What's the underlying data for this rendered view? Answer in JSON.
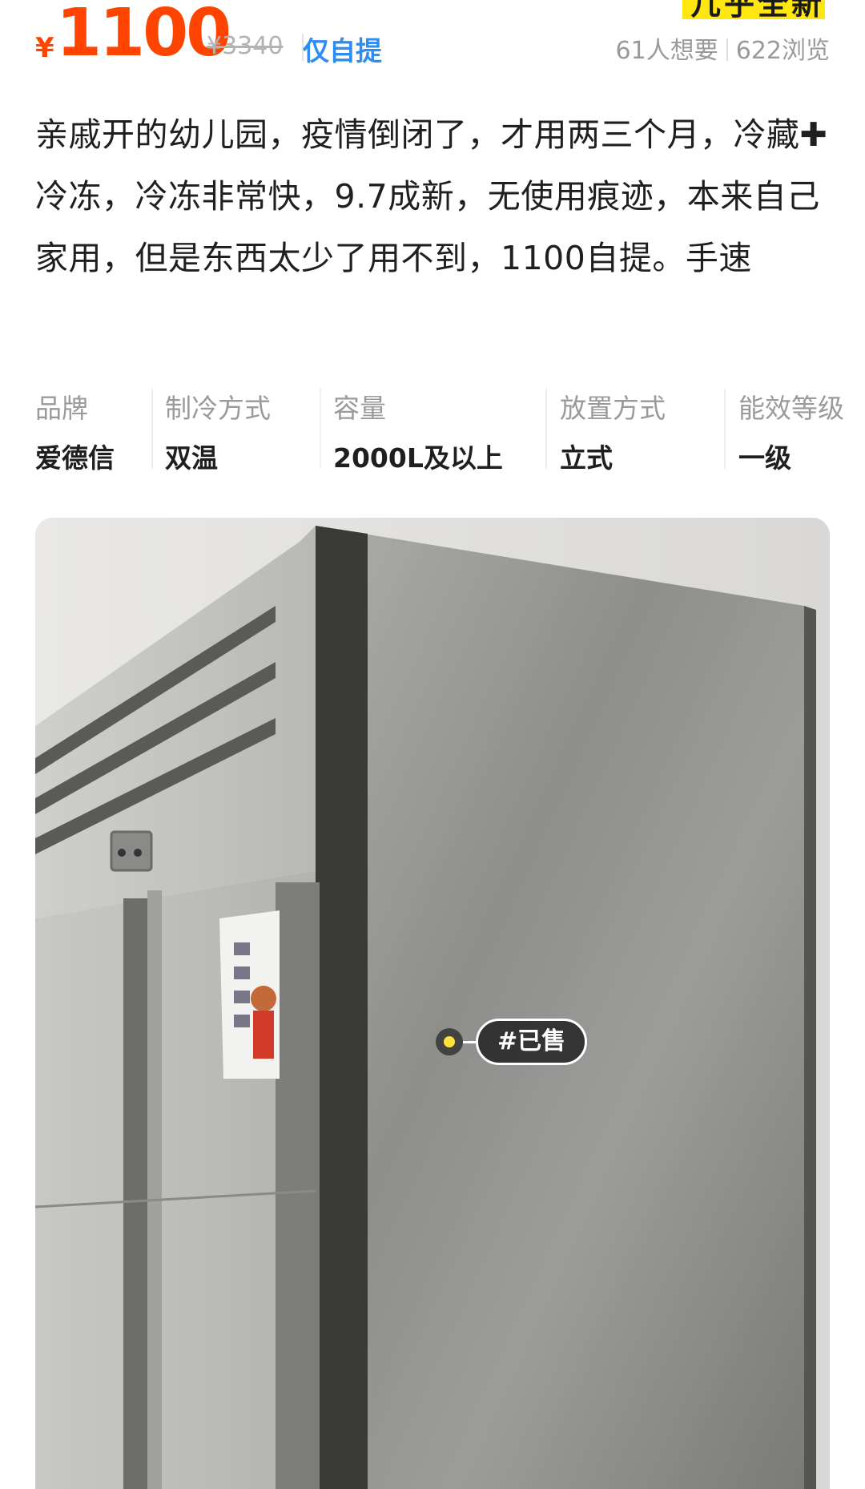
{
  "listing": {
    "currency_symbol": "¥",
    "price": "1100",
    "original_price": "¥3340",
    "delivery": "仅自提",
    "condition_badge": "几乎全新",
    "wants": "61人想要",
    "views": "622浏览"
  },
  "description": {
    "text": "亲戚开的幼儿园，疫情倒闭了，才用两三个月，冷藏✚ 冷冻，冷冻非常快，9.7成新，无使用痕迹，本来自己家用，但是东西太少了用不到，1100自提。手速"
  },
  "attributes": [
    {
      "label": "品牌",
      "value": "爱德信"
    },
    {
      "label": "制冷方式",
      "value": "双温"
    },
    {
      "label": "容量",
      "value": "2000L及以上"
    },
    {
      "label": "放置方式",
      "value": "立式"
    },
    {
      "label": "能效等级",
      "value": "一级"
    }
  ],
  "photo": {
    "tag_label": "#已售"
  },
  "colors": {
    "price": "#ff4400",
    "pickup": "#2f8cf0",
    "badge": "#ffe60f",
    "tag_dot": "#ffe338"
  }
}
